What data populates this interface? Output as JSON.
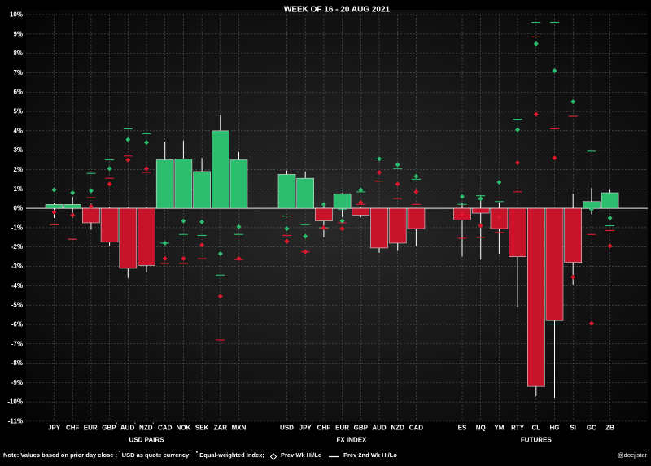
{
  "chart_data": {
    "type": "bar",
    "title": "WEEK OF  16 - 20  AUG 2021",
    "ylim": [
      -11,
      10
    ],
    "yticks": [
      10,
      9,
      8,
      7,
      6,
      5,
      4,
      3,
      2,
      1,
      0,
      -1,
      -2,
      -3,
      -4,
      -5,
      -6,
      -7,
      -8,
      -9,
      -10,
      -11
    ],
    "ytick_labels": [
      "10%",
      "9%",
      "8%",
      "7%",
      "6%",
      "5%",
      "4%",
      "3%",
      "2%",
      "1%",
      "0%",
      "-1%",
      "-2%",
      "-3%",
      "-4%",
      "-5%",
      "-6%",
      "-7%",
      "-8%",
      "-9%",
      "-10%",
      "-11%"
    ],
    "grid": true,
    "up_color": "#2dbd6e",
    "down_color": "#c8142a",
    "groups": [
      {
        "name": "USD PAIRS",
        "items": [
          {
            "label": "JPY",
            "sup": "",
            "value": 0.2,
            "hi": 0.3,
            "lo": -0.5,
            "g": 0.95,
            "r": -0.2,
            "gl": -0.85,
            "rl": -0.85
          },
          {
            "label": "CHF",
            "sup": "",
            "value": 0.2,
            "hi": 0.6,
            "lo": -0.5,
            "g": 0.8,
            "r": -0.35,
            "gl": -1.6,
            "rl": -1.6
          },
          {
            "label": "EUR",
            "sup": "'",
            "value": -0.75,
            "hi": 0.25,
            "lo": -1.1,
            "g": 0.9,
            "r": 0.1,
            "gl": 1.8,
            "rl": 0.55
          },
          {
            "label": "GBP",
            "sup": "'",
            "value": -1.75,
            "hi": 0.05,
            "lo": -1.95,
            "g": 2.05,
            "r": 1.25,
            "gl": 2.5,
            "rl": 1.55
          },
          {
            "label": "AUD",
            "sup": "'",
            "value": -3.1,
            "hi": 0.05,
            "lo": -3.6,
            "g": 3.55,
            "r": 2.5,
            "gl": 4.1,
            "rl": 2.7
          },
          {
            "label": "NZD",
            "sup": "'",
            "value": -2.95,
            "hi": 0.05,
            "lo": -3.3,
            "g": 3.4,
            "r": 2.05,
            "gl": 3.85,
            "rl": 1.85
          },
          {
            "label": "CAD",
            "sup": "",
            "value": 2.5,
            "hi": 3.45,
            "lo": 0,
            "g": -1.8,
            "r": -2.6,
            "gl": -1.8,
            "rl": -2.85
          },
          {
            "label": "NOK",
            "sup": "",
            "value": 2.55,
            "hi": 3.5,
            "lo": 0,
            "g": -0.65,
            "r": -2.6,
            "gl": -1.35,
            "rl": -2.85
          },
          {
            "label": "SEK",
            "sup": "",
            "value": 1.9,
            "hi": 2.6,
            "lo": 0,
            "g": -0.7,
            "r": -1.9,
            "gl": -1.4,
            "rl": -2.6
          },
          {
            "label": "ZAR",
            "sup": "",
            "value": 4.0,
            "hi": 4.8,
            "lo": 0,
            "g": -2.35,
            "r": -4.55,
            "gl": -3.45,
            "rl": -6.8
          },
          {
            "label": "MXN",
            "sup": "",
            "value": 2.5,
            "hi": 2.9,
            "lo": 0,
            "g": -0.95,
            "r": -2.6,
            "gl": -1.35,
            "rl": -2.65
          }
        ]
      },
      {
        "name": "FX INDEX",
        "items": [
          {
            "label": "USD",
            "sup": "",
            "value": 1.75,
            "hi": 1.95,
            "lo": 0,
            "g": -1.05,
            "r": -1.7,
            "gl": -0.4,
            "rl": -1.4
          },
          {
            "label": "JPY",
            "sup": "",
            "value": 1.55,
            "hi": 1.9,
            "lo": 0,
            "g": -1.45,
            "r": -2.25,
            "gl": -0.85,
            "rl": -2.25
          },
          {
            "label": "CHF",
            "sup": "",
            "value": -0.65,
            "hi": 0.1,
            "lo": -1.5,
            "g": 0.2,
            "r": -1.0,
            "gl": -1.0,
            "rl": -1.05
          },
          {
            "label": "EUR",
            "sup": "",
            "value": 0.75,
            "hi": 0.8,
            "lo": -0.45,
            "g": -0.65,
            "r": -1.05,
            "gl": -0.05,
            "rl": -0.75
          },
          {
            "label": "GBP",
            "sup": "",
            "value": -0.35,
            "hi": 0.05,
            "lo": -0.45,
            "g": 0.95,
            "r": 0.3,
            "gl": 0.85,
            "rl": 0.2
          },
          {
            "label": "AUD",
            "sup": "",
            "value": -2.05,
            "hi": 0,
            "lo": -2.3,
            "g": 2.55,
            "r": 1.85,
            "gl": 2.55,
            "rl": 1.4
          },
          {
            "label": "NZD",
            "sup": "",
            "value": -1.8,
            "hi": 0,
            "lo": -2.2,
            "g": 2.25,
            "r": 1.25,
            "gl": 2.05,
            "rl": 0.5
          },
          {
            "label": "CAD",
            "sup": "",
            "value": -1.05,
            "hi": 0,
            "lo": -1.95,
            "g": 1.65,
            "r": 0.85,
            "gl": 1.5,
            "rl": 0.2
          }
        ]
      },
      {
        "name": "FUTURES",
        "items": [
          {
            "label": "ES",
            "sup": "",
            "value": -0.6,
            "hi": 0.3,
            "lo": -2.5,
            "g": 0.6,
            "r": -0.3,
            "gl": 0.2,
            "rl": -1.55
          },
          {
            "label": "NQ",
            "sup": "",
            "value": -0.25,
            "hi": 0.65,
            "lo": -2.65,
            "g": 0.5,
            "r": -0.9,
            "gl": 0.65,
            "rl": -1.5
          },
          {
            "label": "YM",
            "sup": "",
            "value": -1.05,
            "hi": 0.3,
            "lo": -2.35,
            "g": 1.35,
            "r": -0.45,
            "gl": 0.35,
            "rl": -1.25
          },
          {
            "label": "RTY",
            "sup": "",
            "value": -2.5,
            "hi": 0,
            "lo": -5.1,
            "g": 4.05,
            "r": 2.35,
            "gl": 4.6,
            "rl": 0.85
          },
          {
            "label": "CL",
            "sup": "",
            "value": -9.2,
            "hi": 0,
            "lo": -9.7,
            "g": 8.5,
            "r": 4.85,
            "gl": 9.6,
            "rl": 8.85
          },
          {
            "label": "HG",
            "sup": "",
            "value": -5.8,
            "hi": 0,
            "lo": -9.8,
            "g": 7.1,
            "r": 2.6,
            "gl": 9.6,
            "rl": 4.1
          },
          {
            "label": "SI",
            "sup": "",
            "value": -2.8,
            "hi": 0.75,
            "lo": -3.95,
            "g": 5.5,
            "r": -3.55,
            "gl": 4.75,
            "rl": 4.75
          },
          {
            "label": "GC",
            "sup": "",
            "value": 0.35,
            "hi": 1.05,
            "lo": -0.3,
            "g": -0.05,
            "r": -5.95,
            "gl": 2.95,
            "rl": -1.35
          },
          {
            "label": "ZB",
            "sup": "",
            "value": 0.8,
            "hi": 0.95,
            "lo": 0,
            "g": -0.5,
            "r": -1.95,
            "gl": -0.9,
            "rl": -1.15
          }
        ]
      }
    ]
  },
  "footer": {
    "note_left": "Note:  Values based on prior day close ;",
    "sup_mark": "'",
    "usd_quote": " USD as quote currency;",
    "star_mark": "*",
    "eq_index": " Equal-weighted  Index;",
    "legend_diamond": "Prev Wk Hi/Lo",
    "legend_line": "Prev 2nd Wk Hi/Lo",
    "handle": "@doejjstar"
  }
}
